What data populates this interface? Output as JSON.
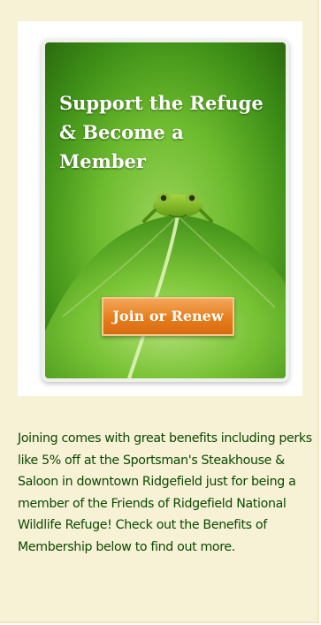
{
  "banner": {
    "title": "Support the Refuge\n& Become a\nMember",
    "button_label": "Join or Renew",
    "image": "tree-frog-on-leaf"
  },
  "description": "Joining comes with great benefits including perks like 5% off at the Sportsman's Steakhouse & Saloon in downtown Ridgefield just for being a member of the Friends of Ridgefield National Wildlife Refuge! Check out the Benefits of Membership below to find out more.",
  "colors": {
    "panel_background": "#f7f1d6",
    "text": "#0a4a00",
    "button": "#e57e1c",
    "banner_green": "#6dbb2e"
  }
}
